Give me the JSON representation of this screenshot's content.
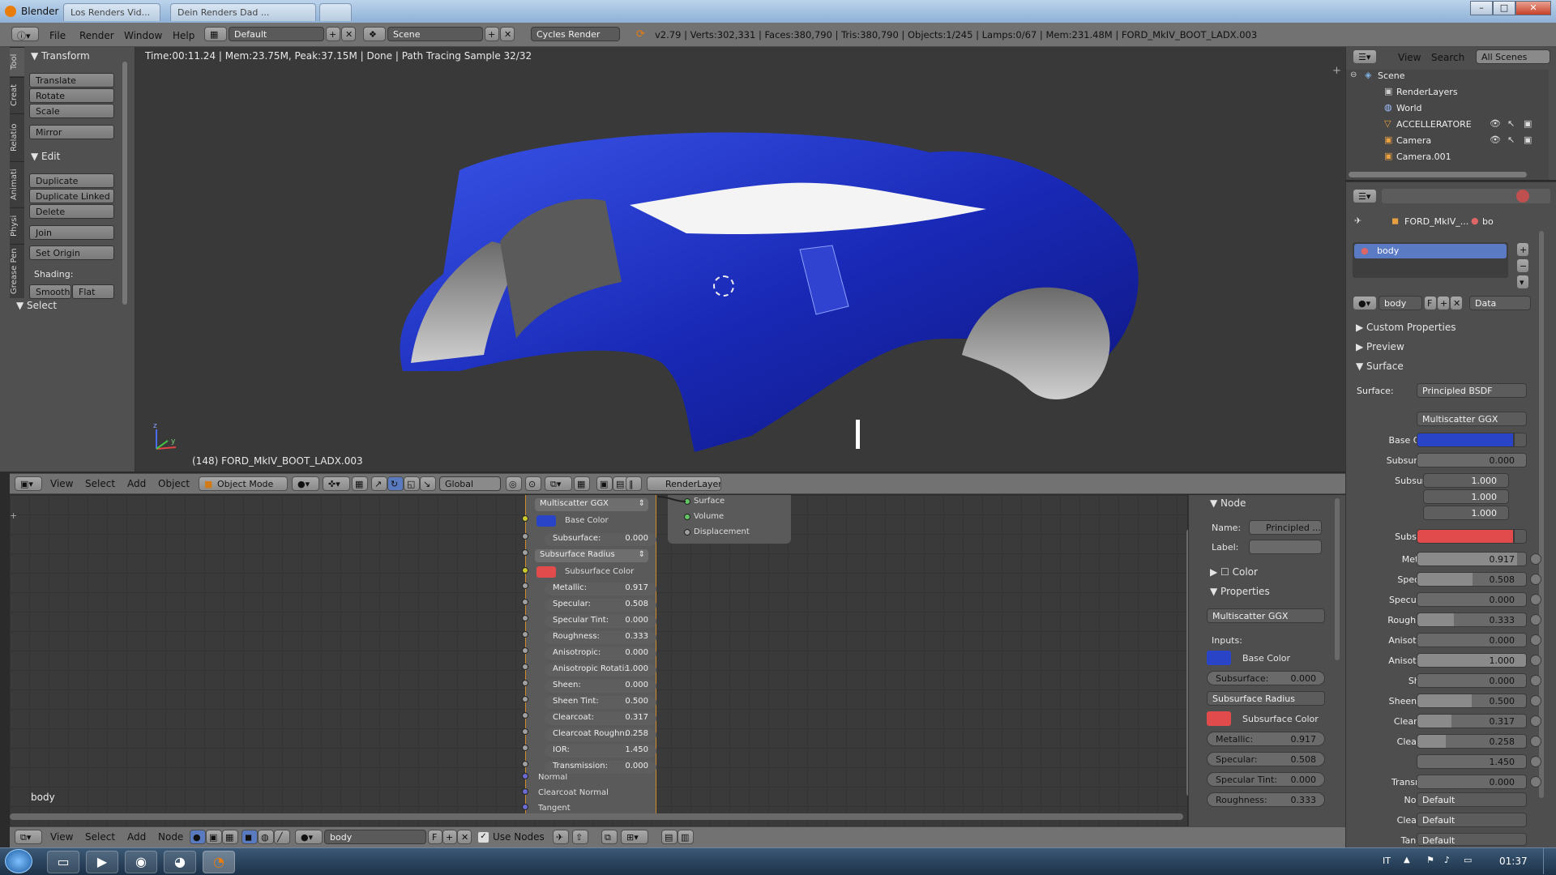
{
  "titlebar": {
    "app_title": "Blender",
    "tabs": [
      "Los Renders Vid...",
      "Dein Renders Dad ..."
    ],
    "controls": [
      "–",
      "□",
      "✕"
    ]
  },
  "menubar": {
    "menus": [
      "File",
      "Render",
      "Window",
      "Help"
    ],
    "layout": "Default",
    "scene": "Scene",
    "engine": "Cycles Render",
    "stats": "v2.79 | Verts:302,331 | Faces:380,790 | Tris:380,790 | Objects:1/245 | Lamps:0/67 | Mem:231.48M | FORD_MkIV_BOOT_LADX.003"
  },
  "viewport": {
    "render_info": "Time:00:11.24 | Mem:23.75M, Peak:37.15M | Done | Path Tracing Sample 32/32",
    "object_label": "(148) FORD_MkIV_BOOT_LADX.003",
    "axis_x": "x",
    "axis_y": "y",
    "axis_z": "z"
  },
  "toolshelf": {
    "tabs": [
      "Tool",
      "Creat",
      "Relatio",
      "Animati",
      "Physi",
      "Grease Pen"
    ],
    "transform_title": "Transform",
    "transform_buttons": [
      "Translate",
      "Rotate",
      "Scale",
      "Mirror"
    ],
    "edit_title": "Edit",
    "edit_buttons": [
      "Duplicate",
      "Duplicate Linked",
      "Delete",
      "Join"
    ],
    "set_origin": "Set Origin",
    "shading_label": "Shading:",
    "smooth": "Smooth",
    "flat": "Flat",
    "select_title": "Select"
  },
  "viewport_header": {
    "menus": [
      "View",
      "Select",
      "Add",
      "Object"
    ],
    "mode": "Object Mode",
    "orientation": "Global",
    "render_layer": "RenderLayer"
  },
  "node_editor": {
    "distribution": "Multiscatter GGX",
    "base_color_label": "Base Color",
    "subsurface_radius": "Subsurface Radius",
    "subsurface_color_label": "Subsurface Color",
    "fields": [
      {
        "label": "Subsurface:",
        "value": "0.000"
      },
      {
        "label": "Metallic:",
        "value": "0.917"
      },
      {
        "label": "Specular:",
        "value": "0.508"
      },
      {
        "label": "Specular Tint:",
        "value": "0.000"
      },
      {
        "label": "Roughness:",
        "value": "0.333"
      },
      {
        "label": "Anisotropic:",
        "value": "0.000"
      },
      {
        "label": "Anisotropic Rotati:",
        "value": "1.000"
      },
      {
        "label": "Sheen:",
        "value": "0.000"
      },
      {
        "label": "Sheen Tint:",
        "value": "0.500"
      },
      {
        "label": "Clearcoat:",
        "value": "0.317"
      },
      {
        "label": "Clearcoat Roughn:",
        "value": "0.258"
      },
      {
        "label": "IOR:",
        "value": "1.450"
      },
      {
        "label": "Transmission:",
        "value": "0.000"
      }
    ],
    "sockets_in": [
      "Normal",
      "Clearcoat Normal",
      "Tangent"
    ],
    "output_sockets": [
      "Surface",
      "Volume",
      "Displacement"
    ],
    "material_label": "body"
  },
  "node_panel": {
    "node_title": "Node",
    "name_label": "Name:",
    "name_value": "Principled ...",
    "label_label": "Label:",
    "color_title": "Color",
    "properties_title": "Properties",
    "distribution": "Multiscatter GGX",
    "inputs_label": "Inputs:",
    "base_color_label": "Base Color",
    "subsurface_radius": "Subsurface Radius",
    "subsurface_color_label": "Subsurface Color",
    "fields_top": [
      {
        "label": "Subsurface:",
        "value": "0.000"
      }
    ],
    "fields_bottom": [
      {
        "label": "Metallic:",
        "value": "0.917"
      },
      {
        "label": "Specular:",
        "value": "0.508"
      },
      {
        "label": "Specular Tint:",
        "value": "0.000"
      },
      {
        "label": "Roughness:",
        "value": "0.333"
      }
    ]
  },
  "node_header": {
    "menus": [
      "View",
      "Select",
      "Add",
      "Node"
    ],
    "material": "body",
    "fake_user": "F",
    "use_nodes": "Use Nodes"
  },
  "outliner": {
    "menus": [
      "View",
      "Search"
    ],
    "filter": "All Scenes",
    "items": [
      "Scene",
      "RenderLayers",
      "World",
      "ACCELLERATORE",
      "Camera",
      "Camera.001"
    ]
  },
  "properties": {
    "breadcrumb_object": "FORD_MkIV_...",
    "breadcrumb_mat": "bo",
    "slot_name": "body",
    "material_name": "body",
    "fake_user": "F",
    "link": "Data",
    "custom_properties": "Custom Properties",
    "preview": "Preview",
    "surface_title": "Surface",
    "surface_label": "Surface:",
    "surface_value": "Principled BSDF",
    "distribution": "Multiscatter GGX",
    "base_color_label": "Base Color:",
    "subsurface_label": "Subsurface:",
    "subsurface_value": "0.000",
    "subsurface_radius_label": "Subsurfac",
    "radius_values": [
      "1.000",
      "1.000",
      "1.000"
    ],
    "subsurface_color_label": "Subsurfac",
    "rows": [
      {
        "label": "Metallic:",
        "value": "0.917",
        "fill": 0.917
      },
      {
        "label": "Specular:",
        "value": "0.508",
        "fill": 0.508
      },
      {
        "label": "Specular ...",
        "value": "0.000",
        "fill": 0
      },
      {
        "label": "Roughness:",
        "value": "0.333",
        "fill": 0.333
      },
      {
        "label": "Anisotrop...",
        "value": "0.000",
        "fill": 0
      },
      {
        "label": "Anisotrop...",
        "value": "1.000",
        "fill": 1
      },
      {
        "label": "Sheen:",
        "value": "0.000",
        "fill": 0
      },
      {
        "label": "Sheen Tint:",
        "value": "0.500",
        "fill": 0.5
      },
      {
        "label": "Clearcoat:",
        "value": "0.317",
        "fill": 0.317
      },
      {
        "label": "Clearcoat",
        "value": "0.258",
        "fill": 0.258
      },
      {
        "label": "IOR:",
        "value": "1.450",
        "fill": 0
      },
      {
        "label": "Transmis...",
        "value": "0.000",
        "fill": 0
      }
    ],
    "normal_label": "Normal:",
    "normal_value": "Default",
    "clearcoat_normal_label": "Clearcoat",
    "clearcoat_normal_value": "Default",
    "tangent_label": "Tangent:",
    "tangent_value": "Default"
  },
  "taskbar": {
    "lang": "IT",
    "time": "01:37"
  },
  "colors": {
    "base_color": "#2a44c8",
    "subsurface_color": "#e24b4b",
    "car_blue": "#1e2fc0"
  }
}
